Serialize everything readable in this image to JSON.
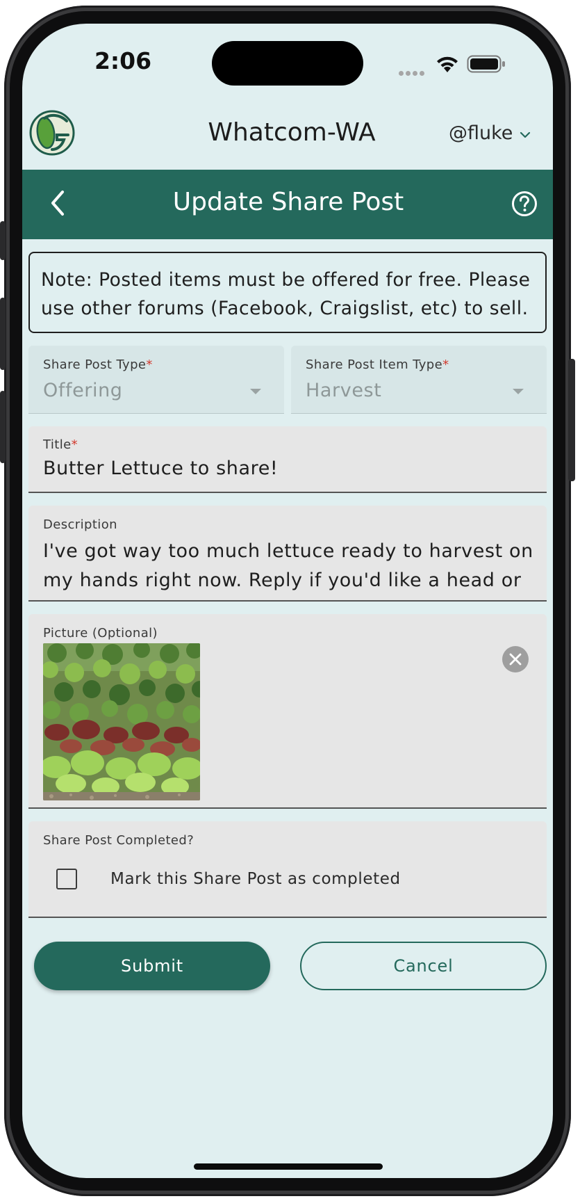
{
  "status_bar": {
    "time": "2:06"
  },
  "header": {
    "region": "Whatcom-WA",
    "username": "@fluke"
  },
  "nav": {
    "title": "Update Share Post"
  },
  "note": {
    "text": "Note: Posted items must be offered for free. Please use other forums (Facebook, Craigslist, etc) to sell."
  },
  "form": {
    "post_type": {
      "label": "Share Post Type",
      "required_mark": "*",
      "value": "Offering"
    },
    "item_type": {
      "label": "Share Post Item Type",
      "required_mark": "*",
      "value": "Harvest"
    },
    "title": {
      "label": "Title",
      "required_mark": "*",
      "value": "Butter Lettuce to share!"
    },
    "description": {
      "label": "Description",
      "value": "I've got way too much lettuce ready to harvest on my hands right now. Reply if you'd like a head or"
    },
    "picture": {
      "label": "Picture (Optional)"
    },
    "completed": {
      "label": "Share Post Completed?",
      "checkbox_label": "Mark this Share Post as completed",
      "checked": false
    }
  },
  "actions": {
    "submit": "Submit",
    "cancel": "Cancel"
  },
  "colors": {
    "primary": "#24695c",
    "background": "#e0eff0",
    "required": "#d23a2e"
  }
}
